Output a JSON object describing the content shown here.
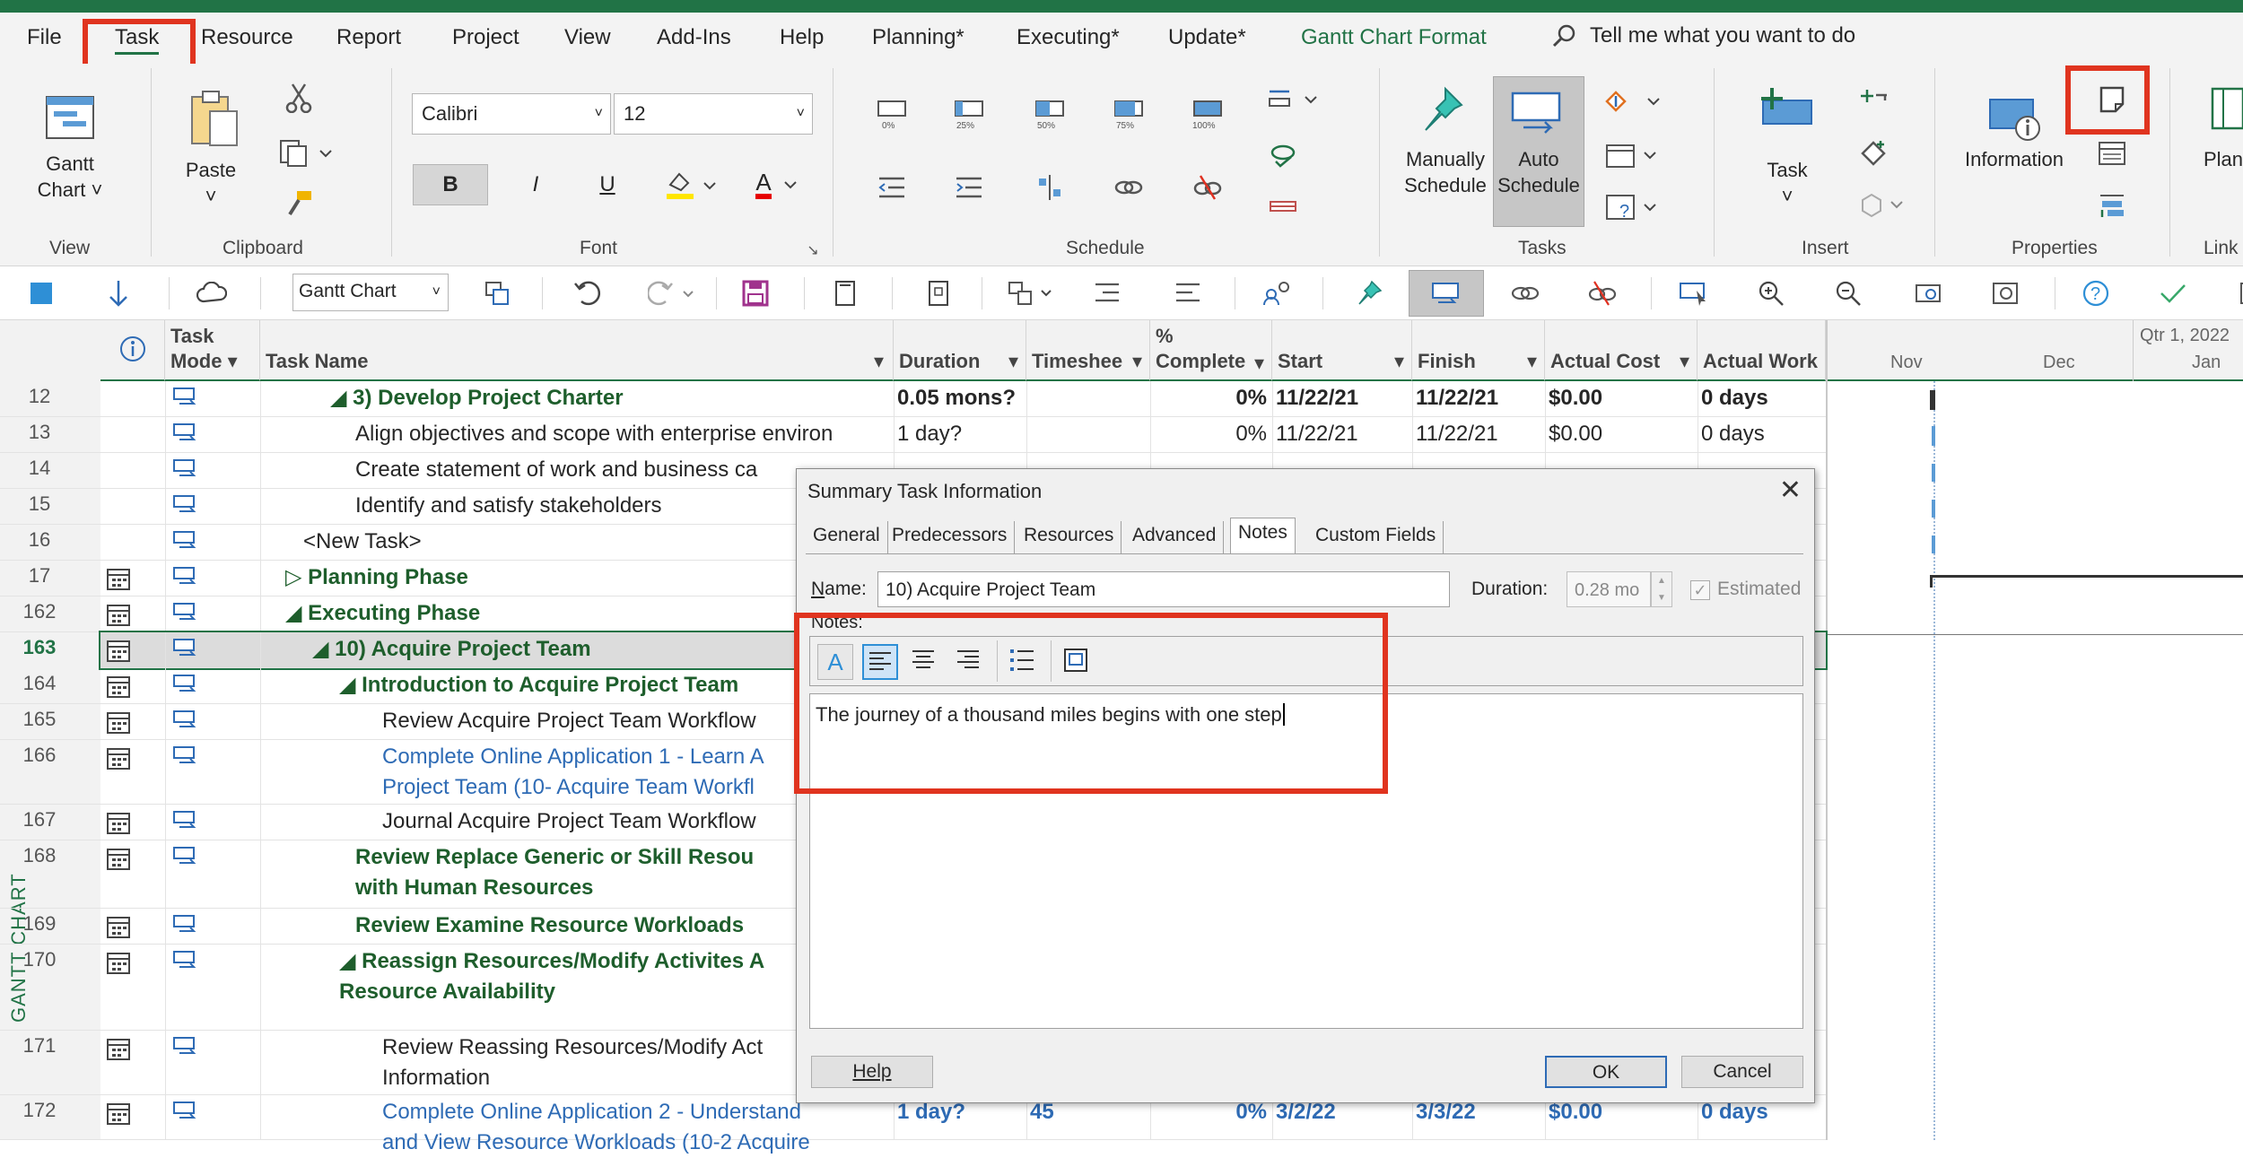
{
  "menu": [
    "File",
    "Task",
    "Resource",
    "Report",
    "Project",
    "View",
    "Add-Ins",
    "Help",
    "Planning*",
    "Executing*",
    "Update*",
    "Gantt Chart Format"
  ],
  "tell_me": "Tell me what you want to do",
  "ribbon": {
    "view": {
      "gantt_label": "Gantt",
      "gantt_label2": "Chart",
      "group": "View"
    },
    "clipboard": {
      "paste": "Paste",
      "group": "Clipboard"
    },
    "font": {
      "family": "Calibri",
      "size": "12",
      "bold": "B",
      "italic": "I",
      "underline": "U",
      "font_color": "A",
      "group": "Font"
    },
    "schedule": {
      "pct": [
        "0%",
        "25%",
        "50%",
        "75%",
        "100%"
      ],
      "group": "Schedule"
    },
    "tasks": {
      "manually": "Manually",
      "manually2": "Schedule",
      "auto": "Auto",
      "auto2": "Schedule",
      "group": "Tasks"
    },
    "insert": {
      "task": "Task",
      "group": "Insert"
    },
    "properties": {
      "information": "Information",
      "group": "Properties"
    },
    "link": {
      "plan": "Plann",
      "group": "Link"
    }
  },
  "qat": {
    "view_combo": "Gantt Chart"
  },
  "vertical_label": "GANTT CHART",
  "columns": {
    "mode": "Task Mode",
    "name": "Task Name",
    "duration": "Duration",
    "timesheet": "Timeshee",
    "complete": "% Complete",
    "start": "Start",
    "finish": "Finish",
    "cost": "Actual Cost",
    "work": "Actual Work"
  },
  "timescale": {
    "top": "Qtr 1, 2022",
    "nov": "Nov",
    "dec": "Dec",
    "jan": "Jan"
  },
  "rows": [
    {
      "id": "12",
      "name": "◢ 3) Develop Project Charter",
      "duration": "0.05 mons?",
      "timesheet": "",
      "complete": "0%",
      "start": "11/22/21",
      "finish": "11/22/21",
      "cost": "$0.00",
      "work": "0 days"
    },
    {
      "id": "13",
      "name": "Align objectives and scope with enterprise environ",
      "duration": "1 day?",
      "timesheet": "",
      "complete": "0%",
      "start": "11/22/21",
      "finish": "11/22/21",
      "cost": "$0.00",
      "work": "0 days"
    },
    {
      "id": "14",
      "name": "Create statement of work and business ca",
      "duration": "",
      "timesheet": "",
      "complete": "",
      "start": "",
      "finish": "",
      "cost": "",
      "work": ""
    },
    {
      "id": "15",
      "name": "Identify and satisfy stakeholders",
      "duration": "",
      "timesheet": "",
      "complete": "",
      "start": "",
      "finish": "",
      "cost": "",
      "work": ""
    },
    {
      "id": "16",
      "name": "<New Task>",
      "duration": "",
      "timesheet": "",
      "complete": "",
      "start": "",
      "finish": "",
      "cost": "",
      "work": ""
    },
    {
      "id": "17",
      "name": "▷ Planning Phase",
      "duration": "",
      "timesheet": "",
      "complete": "",
      "start": "",
      "finish": "",
      "cost": "",
      "work": ""
    },
    {
      "id": "162",
      "name": "◢ Executing Phase",
      "duration": "",
      "timesheet": "",
      "complete": "",
      "start": "",
      "finish": "",
      "cost": "",
      "work": ""
    },
    {
      "id": "163",
      "name": "◢ 10) Acquire Project Team",
      "duration": "",
      "timesheet": "",
      "complete": "",
      "start": "",
      "finish": "",
      "cost": "",
      "work": ""
    },
    {
      "id": "164",
      "name": "◢ Introduction to Acquire Project Team",
      "duration": "",
      "timesheet": "",
      "complete": "",
      "start": "",
      "finish": "",
      "cost": "",
      "work": ""
    },
    {
      "id": "165",
      "name": "Review Acquire Project Team Workflow",
      "duration": "",
      "timesheet": "",
      "complete": "",
      "start": "",
      "finish": "",
      "cost": "",
      "work": ""
    },
    {
      "id": "166",
      "name": "Complete Online Application 1 - Learn A",
      "name2": "Project Team (10- Acquire Team Workfl",
      "duration": "",
      "timesheet": "",
      "complete": "",
      "start": "",
      "finish": "",
      "cost": "",
      "work": ""
    },
    {
      "id": "167",
      "name": "Journal Acquire Project Team Workflow",
      "duration": "",
      "timesheet": "",
      "complete": "",
      "start": "",
      "finish": "",
      "cost": "",
      "work": ""
    },
    {
      "id": "168",
      "name": "Review Replace Generic or Skill Resou",
      "name2": "with Human Resources",
      "duration": "",
      "timesheet": "",
      "complete": "",
      "start": "",
      "finish": "",
      "cost": "",
      "work": ""
    },
    {
      "id": "169",
      "name": "Review Examine Resource Workloads",
      "duration": "",
      "timesheet": "",
      "complete": "",
      "start": "",
      "finish": "",
      "cost": "",
      "work": ""
    },
    {
      "id": "170",
      "name": "◢ Reassign Resources/Modify Activites A",
      "name2": "Resource Availability",
      "duration": "",
      "timesheet": "",
      "complete": "",
      "start": "",
      "finish": "",
      "cost": "",
      "work": ""
    },
    {
      "id": "171",
      "name": "Review Reassing Resources/Modify Act",
      "name2": "Information",
      "duration": "",
      "timesheet": "",
      "complete": "",
      "start": "",
      "finish": "",
      "cost": "",
      "work": ""
    },
    {
      "id": "172",
      "name": "Complete Online Application 2 - Understand",
      "name2": "and View Resource Workloads (10-2 Acquire",
      "duration": "1 day?",
      "timesheet": "45",
      "complete": "0%",
      "start": "3/2/22",
      "finish": "3/3/22",
      "cost": "$0.00",
      "work": "0 days"
    }
  ],
  "dialog": {
    "title": "Summary Task Information",
    "tabs": [
      "General",
      "Predecessors",
      "Resources",
      "Advanced",
      "Notes",
      "Custom Fields"
    ],
    "name_label": "Name:",
    "name_value": "10) Acquire Project Team",
    "duration_label": "Duration:",
    "duration_value": "0.28 mo",
    "estimated_label": "Estimated",
    "notes_label": "Notes:",
    "notes_text": "The journey of a thousand miles begins with one step",
    "help": "Help",
    "ok": "OK",
    "cancel": "Cancel"
  },
  "colors": {
    "accent": "#217346",
    "highlight": "#e0341f",
    "link_blue": "#2e6bb5"
  }
}
